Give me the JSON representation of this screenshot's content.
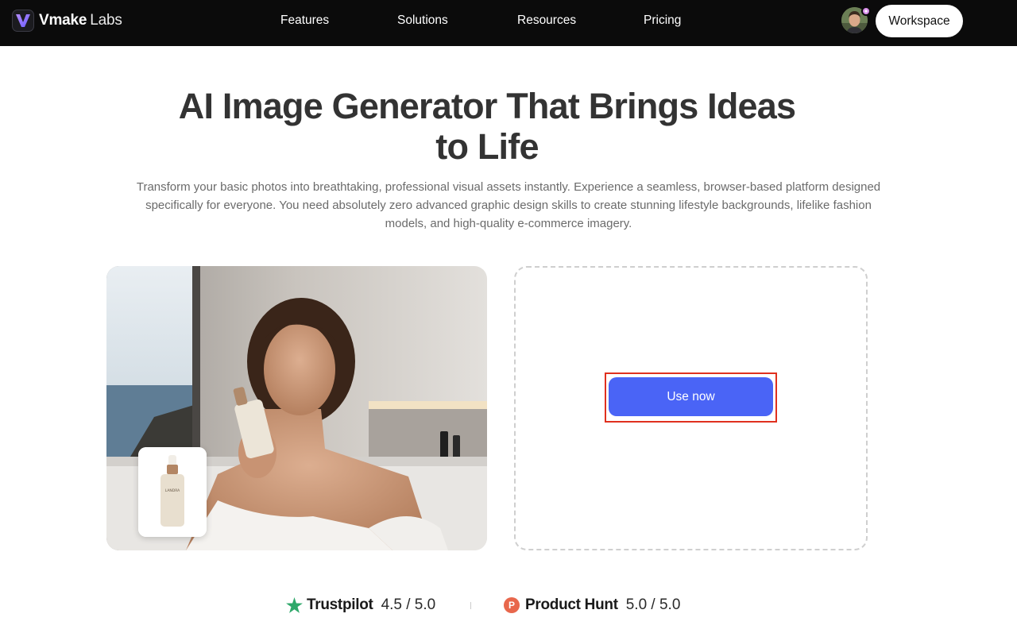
{
  "header": {
    "logo_brand": "Vmake",
    "logo_sub": "Labs",
    "nav": [
      "Features",
      "Solutions",
      "Resources",
      "Pricing"
    ],
    "workspace_label": "Workspace",
    "logo_icon": "vmake-logo-icon",
    "avatar_icon": "user-avatar"
  },
  "hero": {
    "title_line1": "AI Image Generator That Brings Ideas",
    "title_line2": "to Life",
    "description_line1": "Transform your basic photos into breathtaking, professional visual assets instantly. Experience a seamless, browser-based platform designed",
    "description_line2": "specifically for everyone. You need absolutely zero advanced graphic design skills to create stunning lifestyle backgrounds, lifelike fashion",
    "description_line3": "models, and high-quality e-commerce imagery."
  },
  "demo": {
    "product_label": "LANDRA",
    "use_now_label": "Use now",
    "accent_color": "#4a64f6"
  },
  "ratings": {
    "trustpilot_name": "Trustpilot",
    "trustpilot_score": "4.5 / 5.0",
    "trustpilot_icon": "star-icon",
    "producthunt_name": "Product Hunt",
    "producthunt_score": "5.0 / 5.0",
    "producthunt_icon": "product-hunt-icon"
  }
}
